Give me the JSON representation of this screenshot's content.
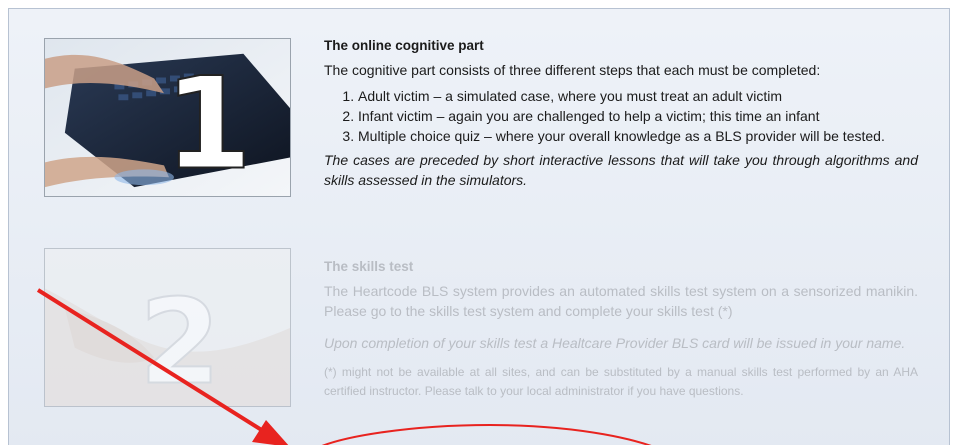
{
  "step1": {
    "number": "1",
    "title": "The online cognitive part",
    "intro": "The cognitive part consists of three different steps that each must be completed:",
    "items": [
      "Adult victim – a simulated case, where you must treat an adult victim",
      "Infant victim – again you are challenged to help a victim; this time an infant",
      "Multiple choice quiz – where your overall knowledge as a BLS provider will be tested."
    ],
    "note": "The cases are preceded by short interactive lessons that will take you through algorithms and skills assessed in the simulators."
  },
  "step2": {
    "number": "2",
    "title": "The skills test",
    "body": "The Heartcode BLS system provides an automated skills test system on a sensorized manikin. Please go to the skills test system and complete your skills test (*)",
    "note": "Upon completion of your skills test a Healtcare Provider BLS card will be issued in your name.",
    "footnote": "(*) might not be available at all sites, and can be substituted by a manual skills test performed by an AHA certified instructor. Please talk to your local administrator if you have questions."
  },
  "colors": {
    "annotation": "#e8231f",
    "panel_border": "#b7c2d2",
    "faded_text": "#b9bdc4"
  }
}
